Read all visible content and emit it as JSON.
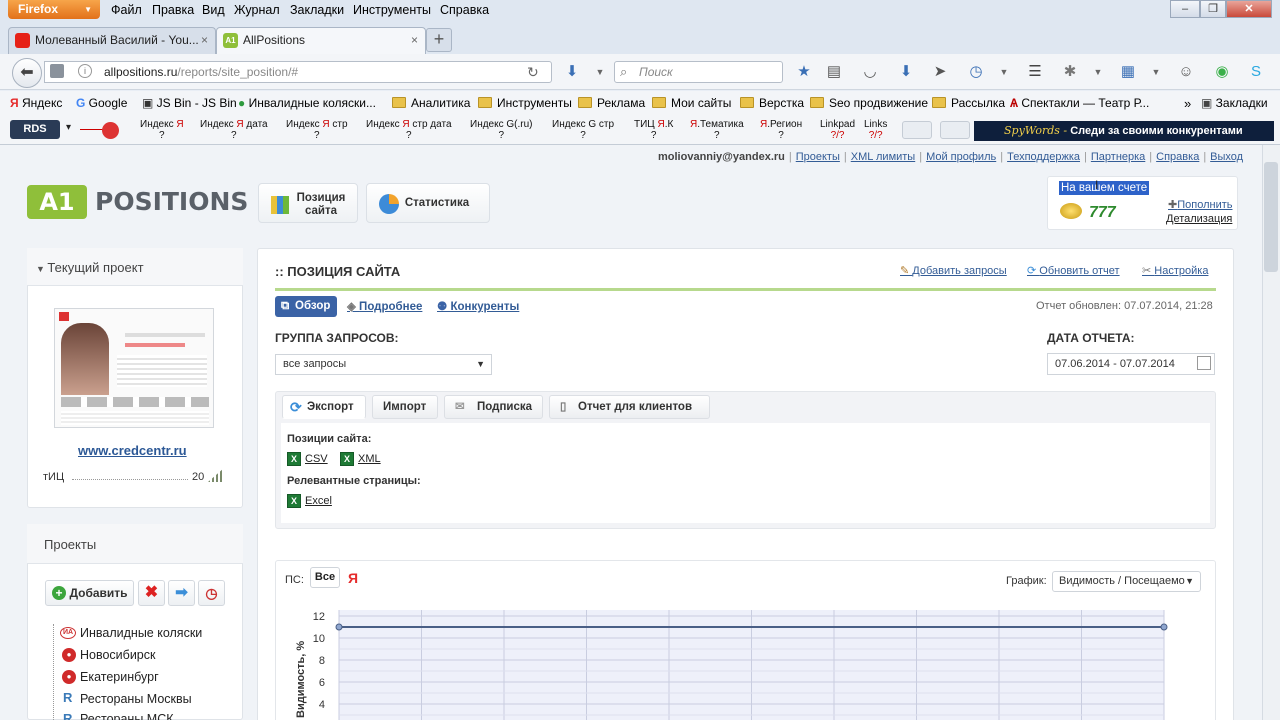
{
  "browser": {
    "app_button": "Firefox",
    "menu": [
      "Файл",
      "Правка",
      "Вид",
      "Журнал",
      "Закладки",
      "Инструменты",
      "Справка"
    ],
    "tabs": [
      {
        "label": "Молеванный Василий - You...",
        "close": "×"
      },
      {
        "label": "AllPositions",
        "close": "×"
      }
    ],
    "new_tab": "+",
    "url_host": "allpositions.ru",
    "url_path": "/reports/site_position/#",
    "search_placeholder": "Поиск",
    "bookmarks": [
      "Яндекс",
      "Google",
      "JS Bin - JS Bin",
      "Инвалидные коляски...",
      "Аналитика",
      "Инструменты",
      "Реклама",
      "Мои сайты",
      "Верстка",
      "Seo продвижение",
      "Рассылка",
      "Спектакли — Театр Р...",
      "Закладки"
    ],
    "addons": {
      "rds": "RDS",
      "items": [
        {
          "l1": "Индекс ",
          "red": "Я",
          "l2": "?"
        },
        {
          "l1": "Индекс ",
          "red": "Я",
          "tail": " дата",
          "l2": "?"
        },
        {
          "l1": "Индекс ",
          "red": "Я",
          "tail": " стр",
          "l2": "?"
        },
        {
          "l1": "Индекс ",
          "red": "Я",
          "tail": " стр дата",
          "l2": "?"
        },
        {
          "l1": "Индекс G(.ru)",
          "red": "",
          "l2": "?"
        },
        {
          "l1": "Индекс G стр",
          "red": "",
          "l2": "?"
        },
        {
          "l1": "ТИЦ ",
          "red": "Я",
          "tail": ".К",
          "l2": "?"
        },
        {
          "l1": "",
          "red": "Я",
          "tail": ".Тематика",
          "l2": "?"
        },
        {
          "l1": "",
          "red": "Я",
          "tail": ".Регион",
          "l2": "?"
        },
        {
          "l1": "Linkpad",
          "red": "",
          "l2": "?/?"
        },
        {
          "l1": "Links",
          "red": "",
          "l2": "?/?"
        }
      ],
      "spywords": "Следи за своими конкурентами",
      "spywords_brand": "SpyWords -"
    }
  },
  "header": {
    "user_email": "moliovanniy@yandex.ru",
    "links": [
      "Проекты",
      "XML лимиты",
      "Мой профиль",
      "Техподдержка",
      "Партнерка",
      "Справка",
      "Выход"
    ],
    "logo_a": "A1",
    "logo_text": "POSITIONS",
    "nav": [
      {
        "label1": "Позиция",
        "label2": "сайта"
      },
      {
        "label1": "Статистика",
        "label2": ""
      }
    ],
    "balance": {
      "title": "На вашем счете",
      "amount": "777",
      "topup": "Пополнить",
      "details": "Детализация"
    }
  },
  "sidebar": {
    "current_project_title": "Текущий проект",
    "site": "www.credcentr.ru",
    "tic_label": "тИЦ",
    "tic_value": "20",
    "projects_title": "Проекты",
    "add_label": "Добавить",
    "projects": [
      "Инвалидные коляски",
      "Новосибирск",
      "Екатеринбург",
      "Рестораны Москвы",
      "Рестораны МСК"
    ]
  },
  "main": {
    "title": ":: ПОЗИЦИЯ САЙТА",
    "actions": [
      "Добавить запросы",
      "Обновить отчет",
      "Настройка"
    ],
    "subtabs": [
      "Обзор",
      "Подробнее",
      "Конкуренты"
    ],
    "updated": "Отчет обновлен: 07.07.2014, 21:28",
    "group_label": "ГРУППА ЗАПРОСОВ:",
    "group_value": "все запросы",
    "date_label": "ДАТА ОТЧЕТА:",
    "date_value": "07.06.2014 - 07.07.2014",
    "export_tabs": [
      "Экспорт",
      "Импорт",
      "Подписка",
      "Отчет для клиентов"
    ],
    "positions_label": "Позиции сайта:",
    "files": [
      "CSV",
      "XML"
    ],
    "relevant_label": "Релевантные страницы:",
    "relevant_file": "Excel",
    "ps_label": "ПС:",
    "ps_all": "Все",
    "ps_yandex": "Я",
    "graph_label": "График:",
    "graph_value": "Видимость / Посещаемо"
  },
  "chart_data": {
    "type": "line",
    "ylabel": "Видимость, %",
    "yticks": [
      4,
      6,
      8,
      10,
      12
    ],
    "ylim": [
      4,
      12
    ],
    "grid": true,
    "series": [
      {
        "values": [
          11,
          11
        ]
      }
    ]
  }
}
